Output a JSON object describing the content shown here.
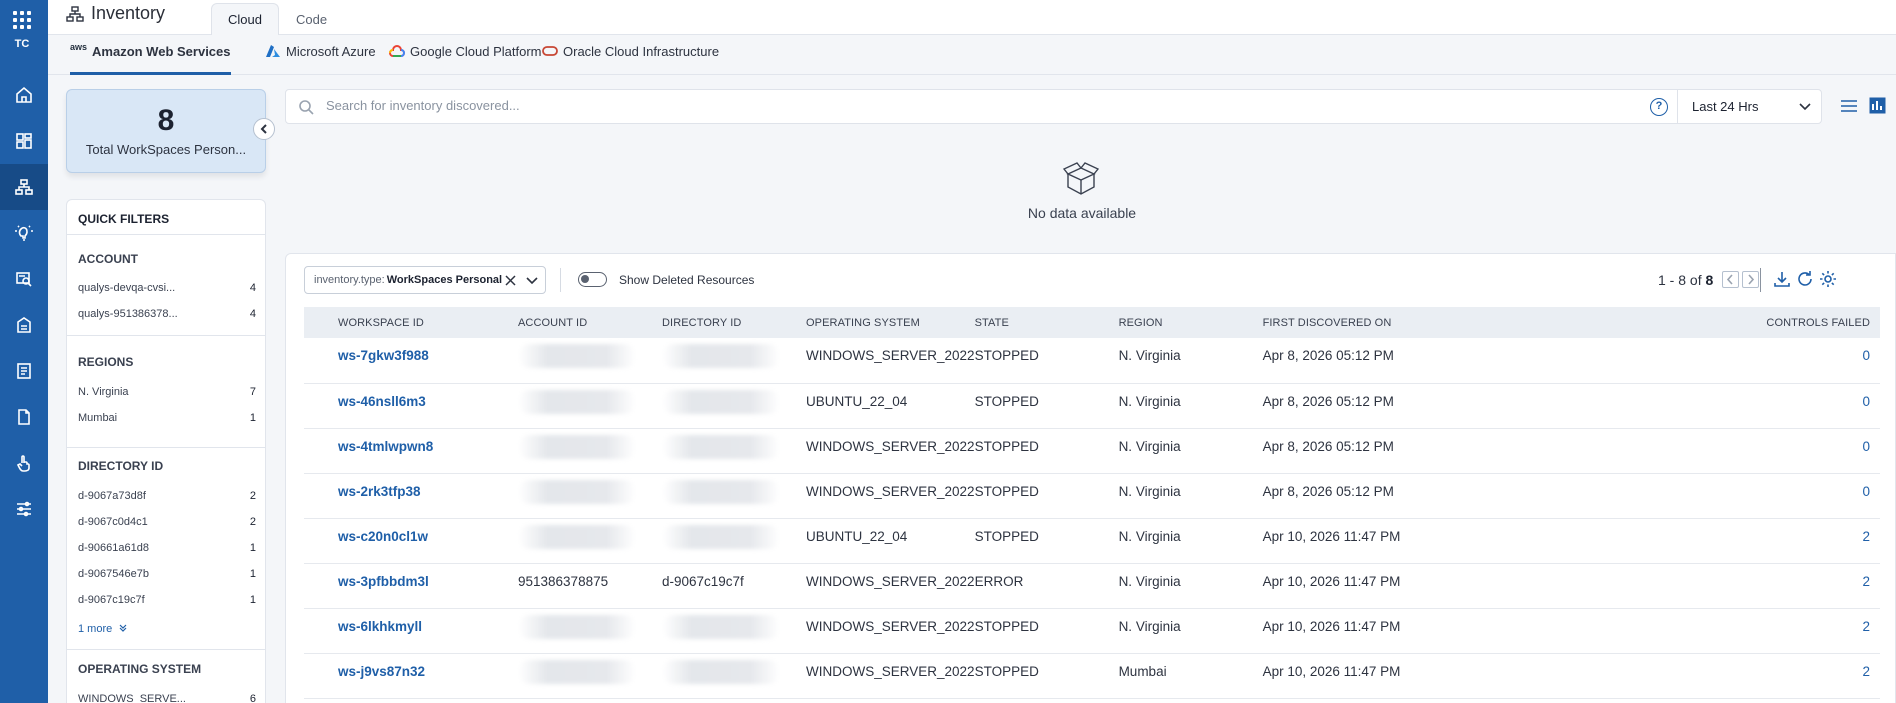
{
  "app": {
    "brand": "TC",
    "title": "Inventory"
  },
  "tabs": [
    {
      "label": "Cloud"
    },
    {
      "label": "Code"
    }
  ],
  "providers": [
    {
      "label": "Amazon Web Services",
      "logo_text": "aws"
    },
    {
      "label": "Microsoft Azure"
    },
    {
      "label": "Google Cloud Platform"
    },
    {
      "label": "Oracle Cloud Infrastructure"
    }
  ],
  "summary": {
    "count": "8",
    "label": "Total WorkSpaces Person..."
  },
  "filters": {
    "heading": "QUICK FILTERS",
    "account": {
      "title": "ACCOUNT",
      "items": [
        {
          "label": "qualys-devqa-cvsi...",
          "count": "4"
        },
        {
          "label": "qualys-951386378...",
          "count": "4"
        }
      ]
    },
    "regions": {
      "title": "REGIONS",
      "items": [
        {
          "label": "N. Virginia",
          "count": "7"
        },
        {
          "label": "Mumbai",
          "count": "1"
        }
      ]
    },
    "directory": {
      "title": "DIRECTORY ID",
      "items": [
        {
          "label": "d-9067a73d8f",
          "count": "2"
        },
        {
          "label": "d-9067c0d4c1",
          "count": "2"
        },
        {
          "label": "d-90661a61d8",
          "count": "1"
        },
        {
          "label": "d-9067546e7b",
          "count": "1"
        },
        {
          "label": "d-9067c19c7f",
          "count": "1"
        }
      ],
      "more": "1 more"
    },
    "os": {
      "title": "OPERATING SYSTEM",
      "items": [
        {
          "label": "WINDOWS_SERVE...",
          "count": "6"
        }
      ]
    }
  },
  "search": {
    "placeholder": "Search for inventory discovered...",
    "help": "?"
  },
  "time_range": {
    "selected": "Last 24 Hrs"
  },
  "empty_state": {
    "text": "No data available"
  },
  "table": {
    "filter_chip": {
      "key": "inventory.type:",
      "value": "WorkSpaces Personal"
    },
    "toggle_label": "Show Deleted Resources",
    "pagination": {
      "range": "1 - 8 of",
      "total": "8"
    },
    "columns": [
      "WORKSPACE ID",
      "ACCOUNT ID",
      "DIRECTORY ID",
      "OPERATING SYSTEM",
      "STATE",
      "REGION",
      "FIRST DISCOVERED ON",
      "CONTROLS FAILED"
    ],
    "rows": [
      {
        "id": "ws-7gkw3f988",
        "account": "",
        "directory": "",
        "os": "WINDOWS_SERVER_2022",
        "state": "STOPPED",
        "region": "N. Virginia",
        "discovered": "Apr 8, 2026 05:12 PM",
        "failed": "0"
      },
      {
        "id": "ws-46nsll6m3",
        "account": "",
        "directory": "",
        "os": "UBUNTU_22_04",
        "state": "STOPPED",
        "region": "N. Virginia",
        "discovered": "Apr 8, 2026 05:12 PM",
        "failed": "0"
      },
      {
        "id": "ws-4tmlwpwn8",
        "account": "",
        "directory": "",
        "os": "WINDOWS_SERVER_2022",
        "state": "STOPPED",
        "region": "N. Virginia",
        "discovered": "Apr 8, 2026 05:12 PM",
        "failed": "0"
      },
      {
        "id": "ws-2rk3tfp38",
        "account": "",
        "directory": "",
        "os": "WINDOWS_SERVER_2022",
        "state": "STOPPED",
        "region": "N. Virginia",
        "discovered": "Apr 8, 2026 05:12 PM",
        "failed": "0"
      },
      {
        "id": "ws-c20n0cl1w",
        "account": "",
        "directory": "",
        "os": "UBUNTU_22_04",
        "state": "STOPPED",
        "region": "N. Virginia",
        "discovered": "Apr 10, 2026 11:47 PM",
        "failed": "2"
      },
      {
        "id": "ws-3pfbbdm3l",
        "account": "951386378875",
        "directory": "d-9067c19c7f",
        "os": "WINDOWS_SERVER_2022",
        "state": "ERROR",
        "region": "N. Virginia",
        "discovered": "Apr 10, 2026 11:47 PM",
        "failed": "2"
      },
      {
        "id": "ws-6lkhkmyll",
        "account": "",
        "directory": "",
        "os": "WINDOWS_SERVER_2022",
        "state": "STOPPED",
        "region": "N. Virginia",
        "discovered": "Apr 10, 2026 11:47 PM",
        "failed": "2"
      },
      {
        "id": "ws-j9vs87n32",
        "account": "",
        "directory": "",
        "os": "WINDOWS_SERVER_2022",
        "state": "STOPPED",
        "region": "Mumbai",
        "discovered": "Apr 10, 2026 11:47 PM",
        "failed": "2"
      }
    ]
  },
  "colors": {
    "nav_bg": "#1f5fa8",
    "nav_active": "#174b87",
    "link": "#1f5fa8",
    "summary_bg": "#d9e7f6"
  }
}
